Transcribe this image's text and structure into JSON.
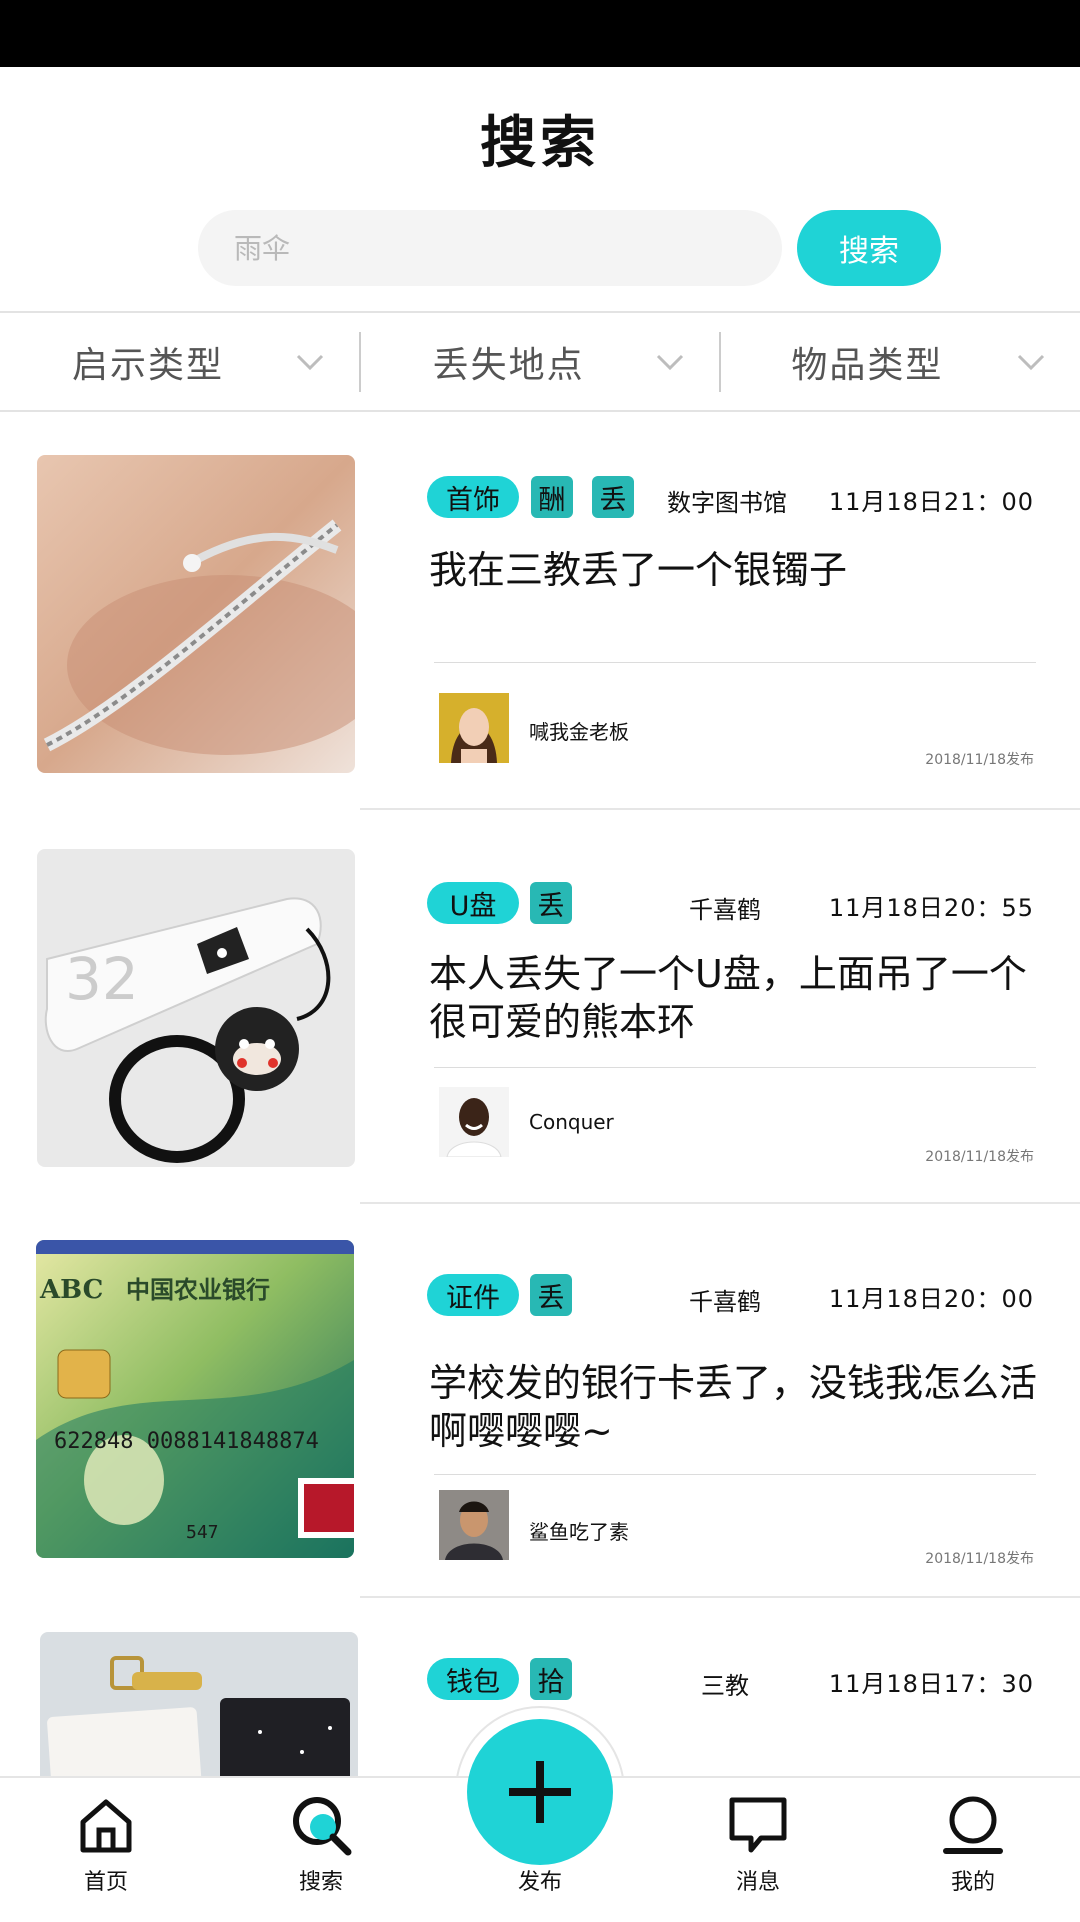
{
  "header": {
    "title": "搜索"
  },
  "search": {
    "placeholder": "雨伞",
    "button": "搜索"
  },
  "filters": [
    {
      "label": "启示类型"
    },
    {
      "label": "丢失地点"
    },
    {
      "label": "物品类型"
    }
  ],
  "cards": [
    {
      "category": "首饰",
      "tags": [
        "酬",
        "丢"
      ],
      "location": "数字图书馆",
      "time": "11月18日21：00",
      "title": "我在三教丢了一个银镯子",
      "user": "喊我金老板",
      "posted": "2018/11/18发布"
    },
    {
      "category": "U盘",
      "tags": [
        "丢"
      ],
      "location": "千喜鹤",
      "time": "11月18日20：55",
      "title": "本人丢失了一个U盘，上面吊了一个很可爱的熊本环",
      "user": "Conquer",
      "posted": "2018/11/18发布"
    },
    {
      "category": "证件",
      "tags": [
        "丢"
      ],
      "location": "千喜鹤",
      "time": "11月18日20：00",
      "title": "学校发的银行卡丢了，没钱我怎么活啊嘤嘤嘤~",
      "user": "鲨鱼吃了素",
      "posted": "2018/11/18发布",
      "card_text": {
        "bank": "中国农业银行",
        "abc": "ABC",
        "number": "622848 0088141848874",
        "small": "547"
      }
    },
    {
      "category": "钱包",
      "tags": [
        "拾"
      ],
      "location": "三教",
      "time": "11月18日17：30"
    }
  ],
  "tabbar": {
    "home": "首页",
    "search": "搜索",
    "publish": "发布",
    "messages": "消息",
    "me": "我的"
  },
  "colors": {
    "accent": "#1fd3d6",
    "tag_dark": "#28b8b4"
  },
  "icons": [
    "home-icon",
    "search-icon",
    "plus-icon",
    "message-icon",
    "profile-icon",
    "chevron-down-icon"
  ]
}
